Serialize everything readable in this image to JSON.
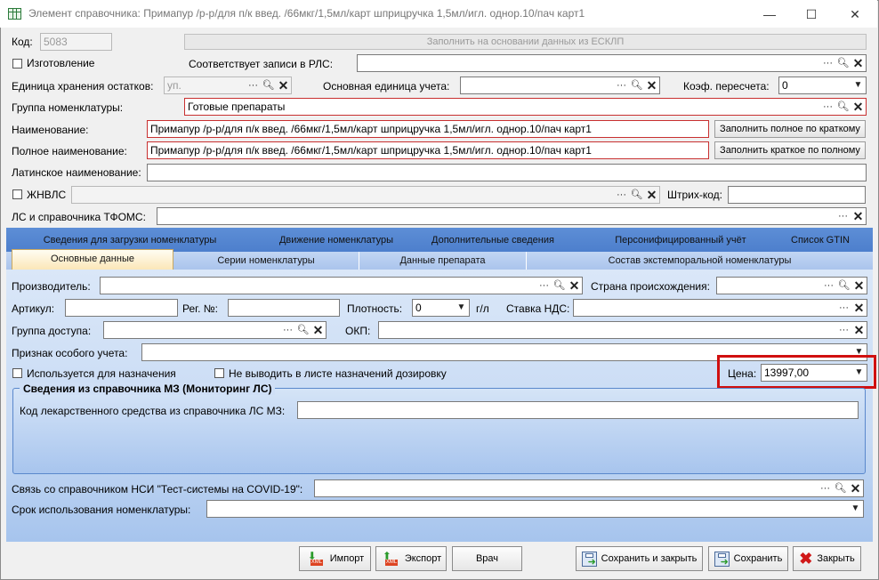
{
  "window": {
    "title": "Элемент справочника: Примапур /р-р/для п/к введ. /66мкг/1,5мл/карт шприцручка 1,5мл/игл. однор.10/пач карт1",
    "minimize": "—",
    "maximize": "☐",
    "close": "✕"
  },
  "header": {
    "code_label": "Код:",
    "code_value": "5083",
    "fill_esklp": "Заполнить на основании данных из ЕСКЛП",
    "manufacture_label": "Изготовление",
    "rls_label": "Соответствует записи в РЛС:",
    "rls_value": "",
    "storage_unit_label": "Единица хранения остатков:",
    "storage_unit_value": "уп.",
    "main_unit_label": "Основная единица учета:",
    "main_unit_value": "",
    "coef_label": "Коэф. пересчета:",
    "coef_value": "0",
    "group_label": "Группа номенклатуры:",
    "group_value": "Готовые препараты",
    "name_label": "Наименование:",
    "name_value": "Примапур /р-р/для п/к введ. /66мкг/1,5мл/карт шприцручка 1,5мл/игл. однор.10/пач карт1",
    "fill_full_btn": "Заполнить полное по краткому",
    "full_name_label": "Полное наименование:",
    "full_name_value": "Примапур /р-р/для п/к введ. /66мкг/1,5мл/карт шприцручка 1,5мл/игл. однор.10/пач карт1",
    "fill_short_btn": "Заполнить краткое по полному",
    "latin_label": "Латинское наименование:",
    "latin_value": "",
    "zhnvls_label": "ЖНВЛС",
    "barcode_label": "Штрих-код:",
    "barcode_value": "",
    "tfoms_label": "ЛС и справочника ТФОМС:",
    "tfoms_value": ""
  },
  "tabs_top": [
    "Сведения для загрузки номенклатуры",
    "Движение номенклатуры",
    "Дополнительные сведения",
    "Персонифицированный учёт",
    "Список GTIN"
  ],
  "tabs_bottom": [
    "Основные данные",
    "Серии номенклатуры",
    "Данные препарата",
    "Состав экстемпоральной номенклатуры"
  ],
  "main": {
    "producer_label": "Производитель:",
    "producer_value": "",
    "country_label": "Страна происхождения:",
    "country_value": "",
    "article_label": "Артикул:",
    "article_value": "",
    "reg_label": "Рег. №:",
    "reg_value": "",
    "density_label": "Плотность:",
    "density_value": "0",
    "density_unit": "г/л",
    "vat_label": "Ставка НДС:",
    "vat_value": "",
    "access_label": "Группа доступа:",
    "access_value": "",
    "okp_label": "ОКП:",
    "okp_value": "",
    "special_label": "Признак особого учета:",
    "special_value": "",
    "used_for_label": "Используется для назначения",
    "no_dose_label": "Не выводить в листе назначений дозировку",
    "price_label": "Цена:",
    "price_value": "13997,00",
    "mz_title": "Сведения из справочника МЗ (Мониторинг ЛС)",
    "mz_code_label": "Код лекарственного средства из справочника ЛС МЗ:",
    "mz_code_value": "",
    "nsi_label": "Связь со справочником НСИ \"Тест-системы на COVID-19\":",
    "nsi_value": "",
    "term_label": "Срок использования номенклатуры:",
    "term_value": ""
  },
  "footer": {
    "import": "Импорт",
    "export": "Экспорт",
    "doctor": "Врач",
    "save_close": "Сохранить и закрыть",
    "save": "Сохранить",
    "close": "Закрыть",
    "xml_badge": "XML"
  },
  "colors": {
    "tab_bar": "#3d70c3",
    "panel": "#c7daf4",
    "required_border": "#c83030",
    "highlight": "#d01010"
  }
}
